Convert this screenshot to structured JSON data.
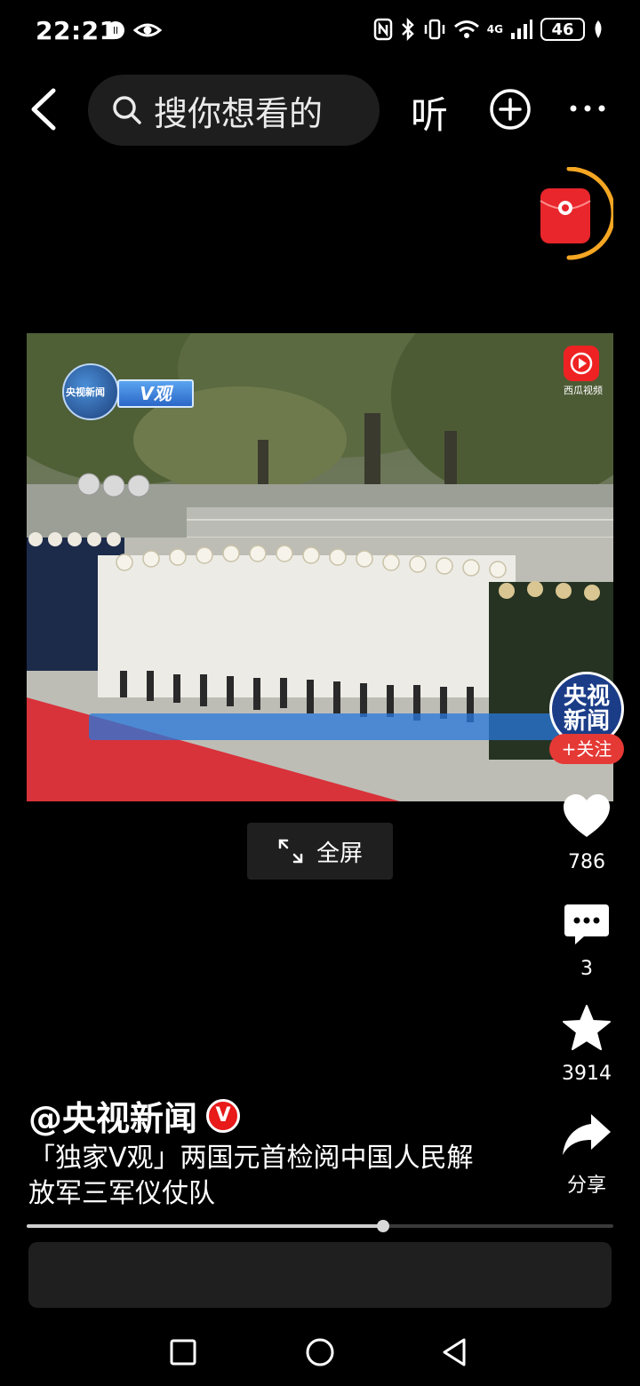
{
  "status_bar": {
    "time": "22:21",
    "network": "4G",
    "battery": "46"
  },
  "top_bar": {
    "search_placeholder": "搜你想看的",
    "listen_label": "听"
  },
  "video": {
    "cctv_label": "央视新闻",
    "vguan_label": "V观",
    "xigua_label": "西瓜视频",
    "progress": 0.608
  },
  "fullscreen": {
    "label": "全屏"
  },
  "actions": {
    "follow_avatar_line1": "央视",
    "follow_avatar_line2": "新闻",
    "follow_label": "+关注",
    "likes": "786",
    "comments": "3",
    "favorites": "3914",
    "share_label": "分享"
  },
  "post": {
    "author": "@央视新闻",
    "verified_mark": "V",
    "description": "「独家V观」两国元首检阅中国人民解放军三军仪仗队"
  },
  "colors": {
    "accent_red": "#e53935",
    "ring_orange": "#f5a623",
    "background": "#000000"
  }
}
